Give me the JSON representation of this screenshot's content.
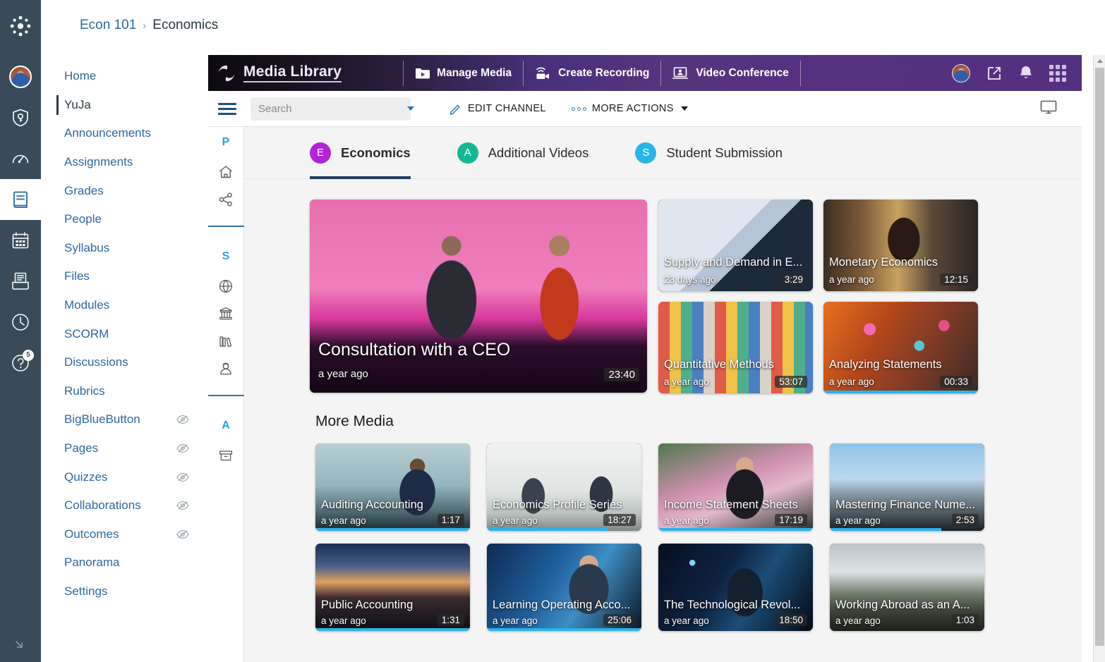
{
  "global_nav": {
    "items": [
      {
        "name": "canvas-logo",
        "label": "Canvas"
      },
      {
        "name": "account",
        "label": "Account"
      },
      {
        "name": "admin",
        "label": "Admin"
      },
      {
        "name": "dashboard",
        "label": "Dashboard"
      },
      {
        "name": "courses",
        "label": "Courses"
      },
      {
        "name": "calendar",
        "label": "Calendar"
      },
      {
        "name": "inbox",
        "label": "Inbox"
      },
      {
        "name": "history",
        "label": "History"
      },
      {
        "name": "help",
        "label": "Help"
      }
    ],
    "help_badge": "5"
  },
  "breadcrumb": {
    "course": "Econ 101",
    "separator": "›",
    "current": "Economics"
  },
  "course_nav": {
    "items": [
      {
        "label": "Home",
        "active": false,
        "hidden": false
      },
      {
        "label": "YuJa",
        "active": true,
        "hidden": false
      },
      {
        "label": "Announcements",
        "active": false,
        "hidden": false
      },
      {
        "label": "Assignments",
        "active": false,
        "hidden": false
      },
      {
        "label": "Grades",
        "active": false,
        "hidden": false
      },
      {
        "label": "People",
        "active": false,
        "hidden": false
      },
      {
        "label": "Syllabus",
        "active": false,
        "hidden": false
      },
      {
        "label": "Files",
        "active": false,
        "hidden": false
      },
      {
        "label": "Modules",
        "active": false,
        "hidden": false
      },
      {
        "label": "SCORM",
        "active": false,
        "hidden": false
      },
      {
        "label": "Discussions",
        "active": false,
        "hidden": false
      },
      {
        "label": "Rubrics",
        "active": false,
        "hidden": false
      },
      {
        "label": "BigBlueButton",
        "active": false,
        "hidden": true
      },
      {
        "label": "Pages",
        "active": false,
        "hidden": true
      },
      {
        "label": "Quizzes",
        "active": false,
        "hidden": true
      },
      {
        "label": "Collaborations",
        "active": false,
        "hidden": true
      },
      {
        "label": "Outcomes",
        "active": false,
        "hidden": true
      },
      {
        "label": "Panorama",
        "active": false,
        "hidden": false
      },
      {
        "label": "Settings",
        "active": false,
        "hidden": false
      }
    ]
  },
  "yuja_header": {
    "brand": "Media Library",
    "actions": [
      {
        "label": "Manage Media",
        "icon": "manage-media-icon"
      },
      {
        "label": "Create Recording",
        "icon": "create-recording-icon"
      },
      {
        "label": "Video Conference",
        "icon": "video-conference-icon"
      }
    ],
    "right_icons": [
      "avatar",
      "external-link-icon",
      "bell-icon",
      "apps-grid-icon"
    ]
  },
  "toolbar": {
    "search_placeholder": "Search",
    "search_value": "",
    "edit_channel": "EDIT CHANNEL",
    "more_actions": "MORE ACTIONS",
    "display_icon": "monitor-icon"
  },
  "rail": {
    "sections": [
      {
        "letter": "P",
        "icons": [
          "home-icon",
          "share-icon"
        ]
      },
      {
        "letter": "S",
        "icons": [
          "globe-icon",
          "institution-icon",
          "library-icon",
          "user-group-icon"
        ]
      },
      {
        "letter": "A",
        "icons": [
          "archive-box-icon"
        ]
      }
    ]
  },
  "tabs": [
    {
      "initial": "E",
      "label": "Economics",
      "color": "#b223d6",
      "active": true
    },
    {
      "initial": "A",
      "label": "Additional Videos",
      "color": "#12b892",
      "active": false
    },
    {
      "initial": "S",
      "label": "Student Submission",
      "color": "#2ab4e8",
      "active": false
    }
  ],
  "featured": {
    "title": "Consultation with a CEO",
    "age": "a year ago",
    "duration": "23:40",
    "thumb": "t-ceo",
    "progress_pct": 0
  },
  "featured_side": [
    {
      "title": "Supply and Demand in E...",
      "age": "23 days ago",
      "duration": "3:29",
      "thumb": "t-supply",
      "progress_pct": 0
    },
    {
      "title": "Monetary Economics",
      "age": "a year ago",
      "duration": "12:15",
      "thumb": "t-monetary",
      "progress_pct": 0
    },
    {
      "title": "Quantitative Methods",
      "age": "a year ago",
      "duration": "53:07",
      "thumb": "t-quant",
      "progress_pct": 0
    },
    {
      "title": "Analyzing Statements",
      "age": "a year ago",
      "duration": "00:33",
      "thumb": "t-analyze",
      "progress_pct": 100
    }
  ],
  "more_media": {
    "heading": "More Media",
    "items": [
      {
        "title": "Auditing Accounting",
        "age": "a year ago",
        "duration": "1:17",
        "thumb": "t-audit",
        "progress_pct": 100
      },
      {
        "title": "Economics Profile Series",
        "age": "a year ago",
        "duration": "18:27",
        "thumb": "t-profile",
        "progress_pct": 78
      },
      {
        "title": "Income Statement Sheets",
        "age": "a year ago",
        "duration": "17:19",
        "thumb": "t-income",
        "progress_pct": 100
      },
      {
        "title": "Mastering Finance Nume...",
        "age": "a year ago",
        "duration": "2:53",
        "thumb": "t-finance",
        "progress_pct": 72
      },
      {
        "title": "Public Accounting",
        "age": "a year ago",
        "duration": "1:31",
        "thumb": "t-public",
        "progress_pct": 100
      },
      {
        "title": "Learning Operating Acco...",
        "age": "a year ago",
        "duration": "25:06",
        "thumb": "t-learning",
        "progress_pct": 100
      },
      {
        "title": "The Technological Revol...",
        "age": "a year ago",
        "duration": "18:50",
        "thumb": "t-tech",
        "progress_pct": 0
      },
      {
        "title": "Working Abroad as an A...",
        "age": "a year ago",
        "duration": "1:03",
        "thumb": "t-abroad",
        "progress_pct": 0
      }
    ]
  },
  "colors": {
    "canvas_nav": "#394B58",
    "canvas_link": "#2D68A1",
    "yuja_purple": "#553180",
    "progress_cyan": "#2ab4ea",
    "rail_accent": "#27A3E6"
  }
}
